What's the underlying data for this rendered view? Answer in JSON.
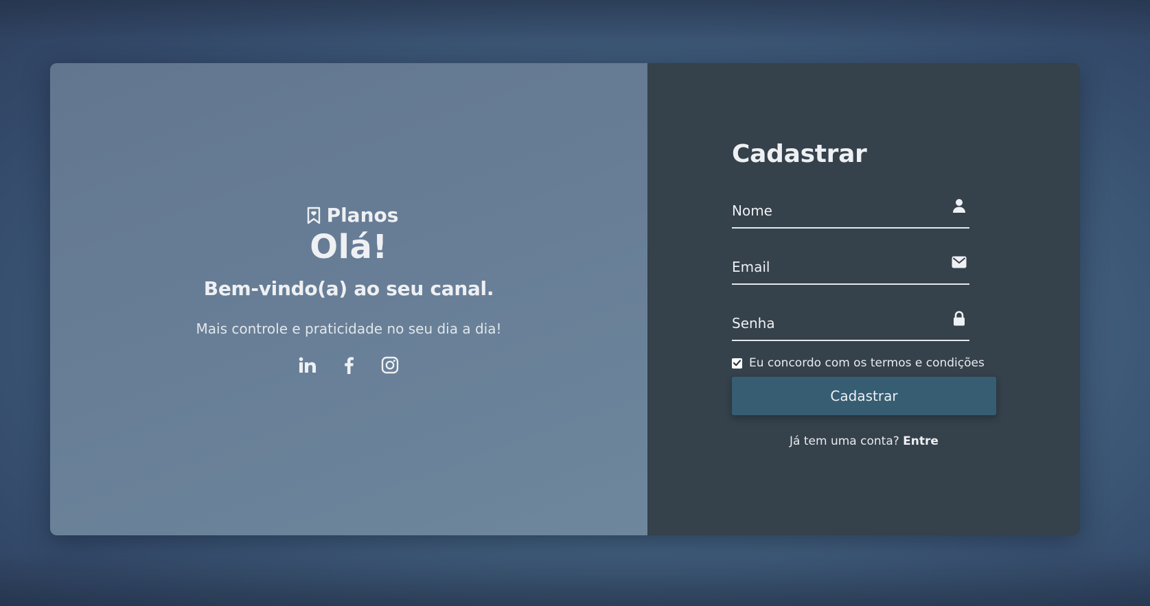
{
  "left_panel": {
    "brand": {
      "icon": "bookmark-heart-icon",
      "name": "Planos"
    },
    "greeting": "Olá!",
    "welcome": "Bem-vindo(a) ao seu canal.",
    "tagline": "Mais controle e praticidade no seu dia a dia!",
    "socials": [
      {
        "icon": "linkedin-icon"
      },
      {
        "icon": "facebook-icon"
      },
      {
        "icon": "instagram-icon"
      }
    ]
  },
  "signup_form": {
    "title": "Cadastrar",
    "fields": {
      "name": {
        "placeholder": "Nome",
        "value": "",
        "icon": "user-icon"
      },
      "email": {
        "placeholder": "Email",
        "value": "",
        "icon": "envelope-icon"
      },
      "password": {
        "placeholder": "Senha",
        "value": "",
        "icon": "lock-icon"
      }
    },
    "terms": {
      "label": "Eu concordo com os termos e condições",
      "checked": true
    },
    "submit_label": "Cadastrar",
    "login_prompt": "Já tem uma conta?",
    "login_link": "Entre"
  },
  "colors": {
    "left_panel": "#687f97",
    "right_panel": "#35414b",
    "button": "#375d73",
    "text": "#eef0f3"
  }
}
